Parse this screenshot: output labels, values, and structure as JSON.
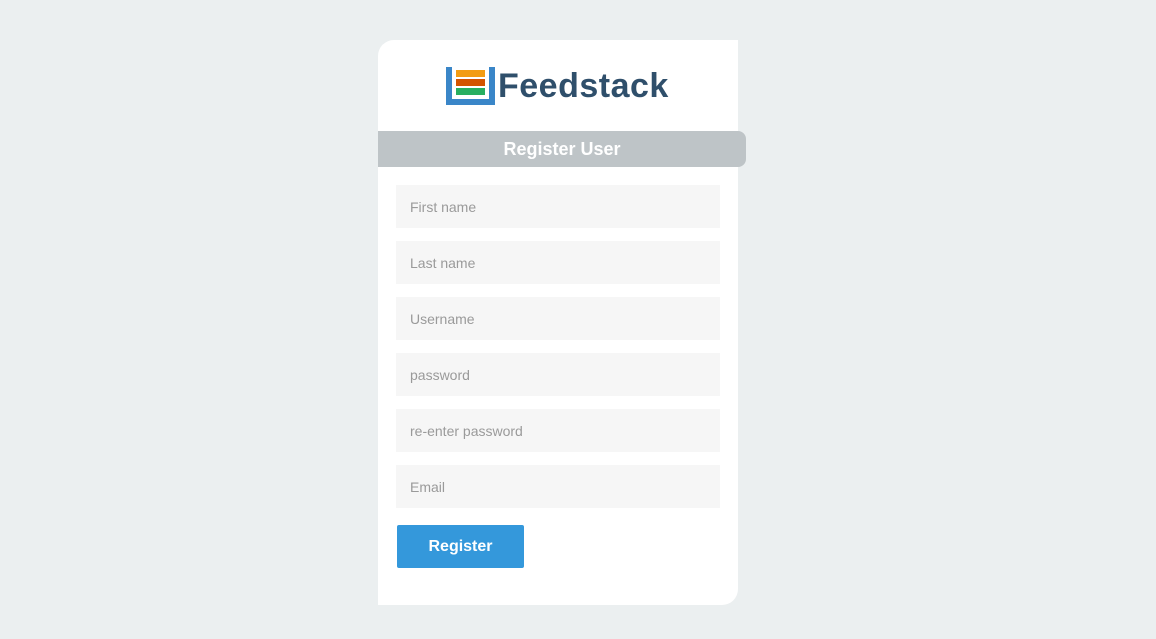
{
  "brand": {
    "name": "Feedstack",
    "logo_icon": "stacked-feed-logo-icon",
    "colors": {
      "frame": "#3a86c8",
      "bar_top": "#f39c12",
      "bar_mid": "#d35400",
      "bar_bottom": "#27ae60",
      "text": "#2f4f6b"
    }
  },
  "form": {
    "title": "Register User",
    "fields": [
      {
        "placeholder": "First name",
        "value": ""
      },
      {
        "placeholder": "Last name",
        "value": ""
      },
      {
        "placeholder": "Username",
        "value": ""
      },
      {
        "placeholder": "password",
        "value": ""
      },
      {
        "placeholder": "re-enter password",
        "value": ""
      },
      {
        "placeholder": "Email",
        "value": ""
      }
    ],
    "submit_label": "Register"
  },
  "colors": {
    "background": "#ebeff0",
    "header_bar": "#bec4c7",
    "input_bg": "#f6f6f6",
    "button": "#3498db"
  }
}
